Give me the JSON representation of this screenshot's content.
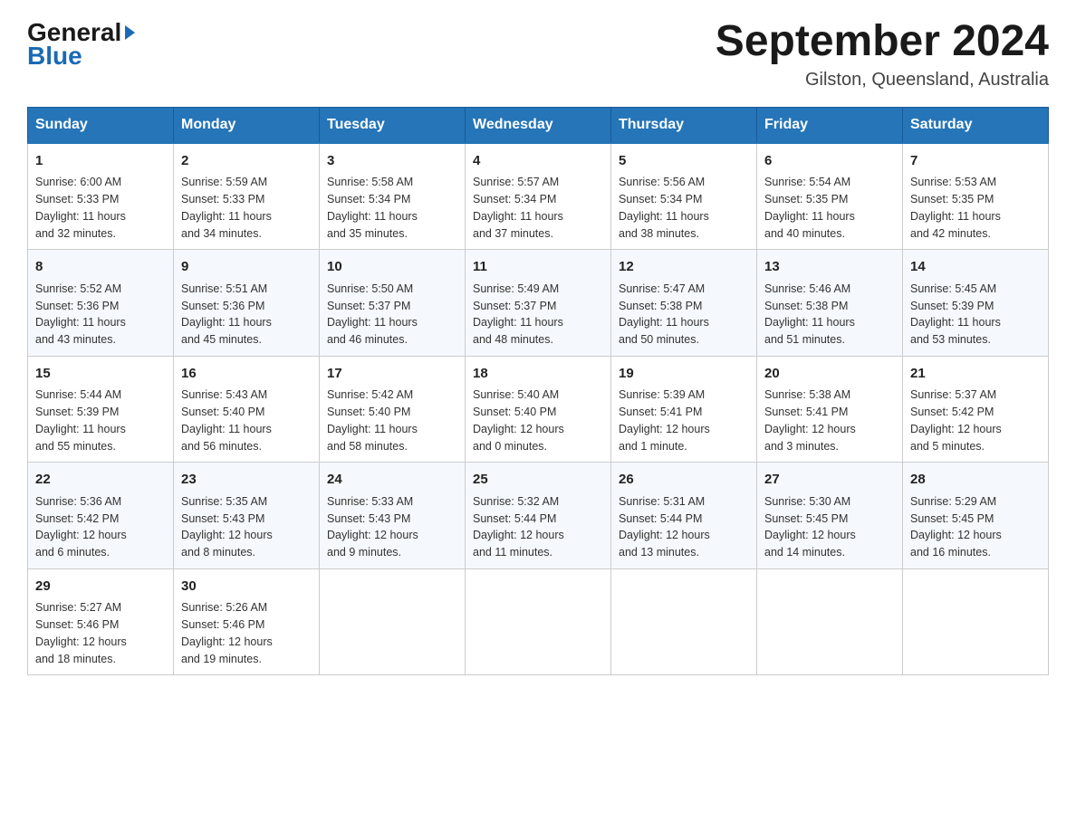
{
  "logo": {
    "general": "General",
    "triangle": "▶",
    "blue": "Blue"
  },
  "header": {
    "title": "September 2024",
    "subtitle": "Gilston, Queensland, Australia"
  },
  "weekdays": [
    "Sunday",
    "Monday",
    "Tuesday",
    "Wednesday",
    "Thursday",
    "Friday",
    "Saturday"
  ],
  "weeks": [
    [
      {
        "day": "1",
        "sunrise": "6:00 AM",
        "sunset": "5:33 PM",
        "daylight": "11 hours and 32 minutes."
      },
      {
        "day": "2",
        "sunrise": "5:59 AM",
        "sunset": "5:33 PM",
        "daylight": "11 hours and 34 minutes."
      },
      {
        "day": "3",
        "sunrise": "5:58 AM",
        "sunset": "5:34 PM",
        "daylight": "11 hours and 35 minutes."
      },
      {
        "day": "4",
        "sunrise": "5:57 AM",
        "sunset": "5:34 PM",
        "daylight": "11 hours and 37 minutes."
      },
      {
        "day": "5",
        "sunrise": "5:56 AM",
        "sunset": "5:34 PM",
        "daylight": "11 hours and 38 minutes."
      },
      {
        "day": "6",
        "sunrise": "5:54 AM",
        "sunset": "5:35 PM",
        "daylight": "11 hours and 40 minutes."
      },
      {
        "day": "7",
        "sunrise": "5:53 AM",
        "sunset": "5:35 PM",
        "daylight": "11 hours and 42 minutes."
      }
    ],
    [
      {
        "day": "8",
        "sunrise": "5:52 AM",
        "sunset": "5:36 PM",
        "daylight": "11 hours and 43 minutes."
      },
      {
        "day": "9",
        "sunrise": "5:51 AM",
        "sunset": "5:36 PM",
        "daylight": "11 hours and 45 minutes."
      },
      {
        "day": "10",
        "sunrise": "5:50 AM",
        "sunset": "5:37 PM",
        "daylight": "11 hours and 46 minutes."
      },
      {
        "day": "11",
        "sunrise": "5:49 AM",
        "sunset": "5:37 PM",
        "daylight": "11 hours and 48 minutes."
      },
      {
        "day": "12",
        "sunrise": "5:47 AM",
        "sunset": "5:38 PM",
        "daylight": "11 hours and 50 minutes."
      },
      {
        "day": "13",
        "sunrise": "5:46 AM",
        "sunset": "5:38 PM",
        "daylight": "11 hours and 51 minutes."
      },
      {
        "day": "14",
        "sunrise": "5:45 AM",
        "sunset": "5:39 PM",
        "daylight": "11 hours and 53 minutes."
      }
    ],
    [
      {
        "day": "15",
        "sunrise": "5:44 AM",
        "sunset": "5:39 PM",
        "daylight": "11 hours and 55 minutes."
      },
      {
        "day": "16",
        "sunrise": "5:43 AM",
        "sunset": "5:40 PM",
        "daylight": "11 hours and 56 minutes."
      },
      {
        "day": "17",
        "sunrise": "5:42 AM",
        "sunset": "5:40 PM",
        "daylight": "11 hours and 58 minutes."
      },
      {
        "day": "18",
        "sunrise": "5:40 AM",
        "sunset": "5:40 PM",
        "daylight": "12 hours and 0 minutes."
      },
      {
        "day": "19",
        "sunrise": "5:39 AM",
        "sunset": "5:41 PM",
        "daylight": "12 hours and 1 minute."
      },
      {
        "day": "20",
        "sunrise": "5:38 AM",
        "sunset": "5:41 PM",
        "daylight": "12 hours and 3 minutes."
      },
      {
        "day": "21",
        "sunrise": "5:37 AM",
        "sunset": "5:42 PM",
        "daylight": "12 hours and 5 minutes."
      }
    ],
    [
      {
        "day": "22",
        "sunrise": "5:36 AM",
        "sunset": "5:42 PM",
        "daylight": "12 hours and 6 minutes."
      },
      {
        "day": "23",
        "sunrise": "5:35 AM",
        "sunset": "5:43 PM",
        "daylight": "12 hours and 8 minutes."
      },
      {
        "day": "24",
        "sunrise": "5:33 AM",
        "sunset": "5:43 PM",
        "daylight": "12 hours and 9 minutes."
      },
      {
        "day": "25",
        "sunrise": "5:32 AM",
        "sunset": "5:44 PM",
        "daylight": "12 hours and 11 minutes."
      },
      {
        "day": "26",
        "sunrise": "5:31 AM",
        "sunset": "5:44 PM",
        "daylight": "12 hours and 13 minutes."
      },
      {
        "day": "27",
        "sunrise": "5:30 AM",
        "sunset": "5:45 PM",
        "daylight": "12 hours and 14 minutes."
      },
      {
        "day": "28",
        "sunrise": "5:29 AM",
        "sunset": "5:45 PM",
        "daylight": "12 hours and 16 minutes."
      }
    ],
    [
      {
        "day": "29",
        "sunrise": "5:27 AM",
        "sunset": "5:46 PM",
        "daylight": "12 hours and 18 minutes."
      },
      {
        "day": "30",
        "sunrise": "5:26 AM",
        "sunset": "5:46 PM",
        "daylight": "12 hours and 19 minutes."
      },
      null,
      null,
      null,
      null,
      null
    ]
  ],
  "labels": {
    "sunrise_prefix": "Sunrise: ",
    "sunset_prefix": "Sunset: ",
    "daylight_prefix": "Daylight: "
  }
}
